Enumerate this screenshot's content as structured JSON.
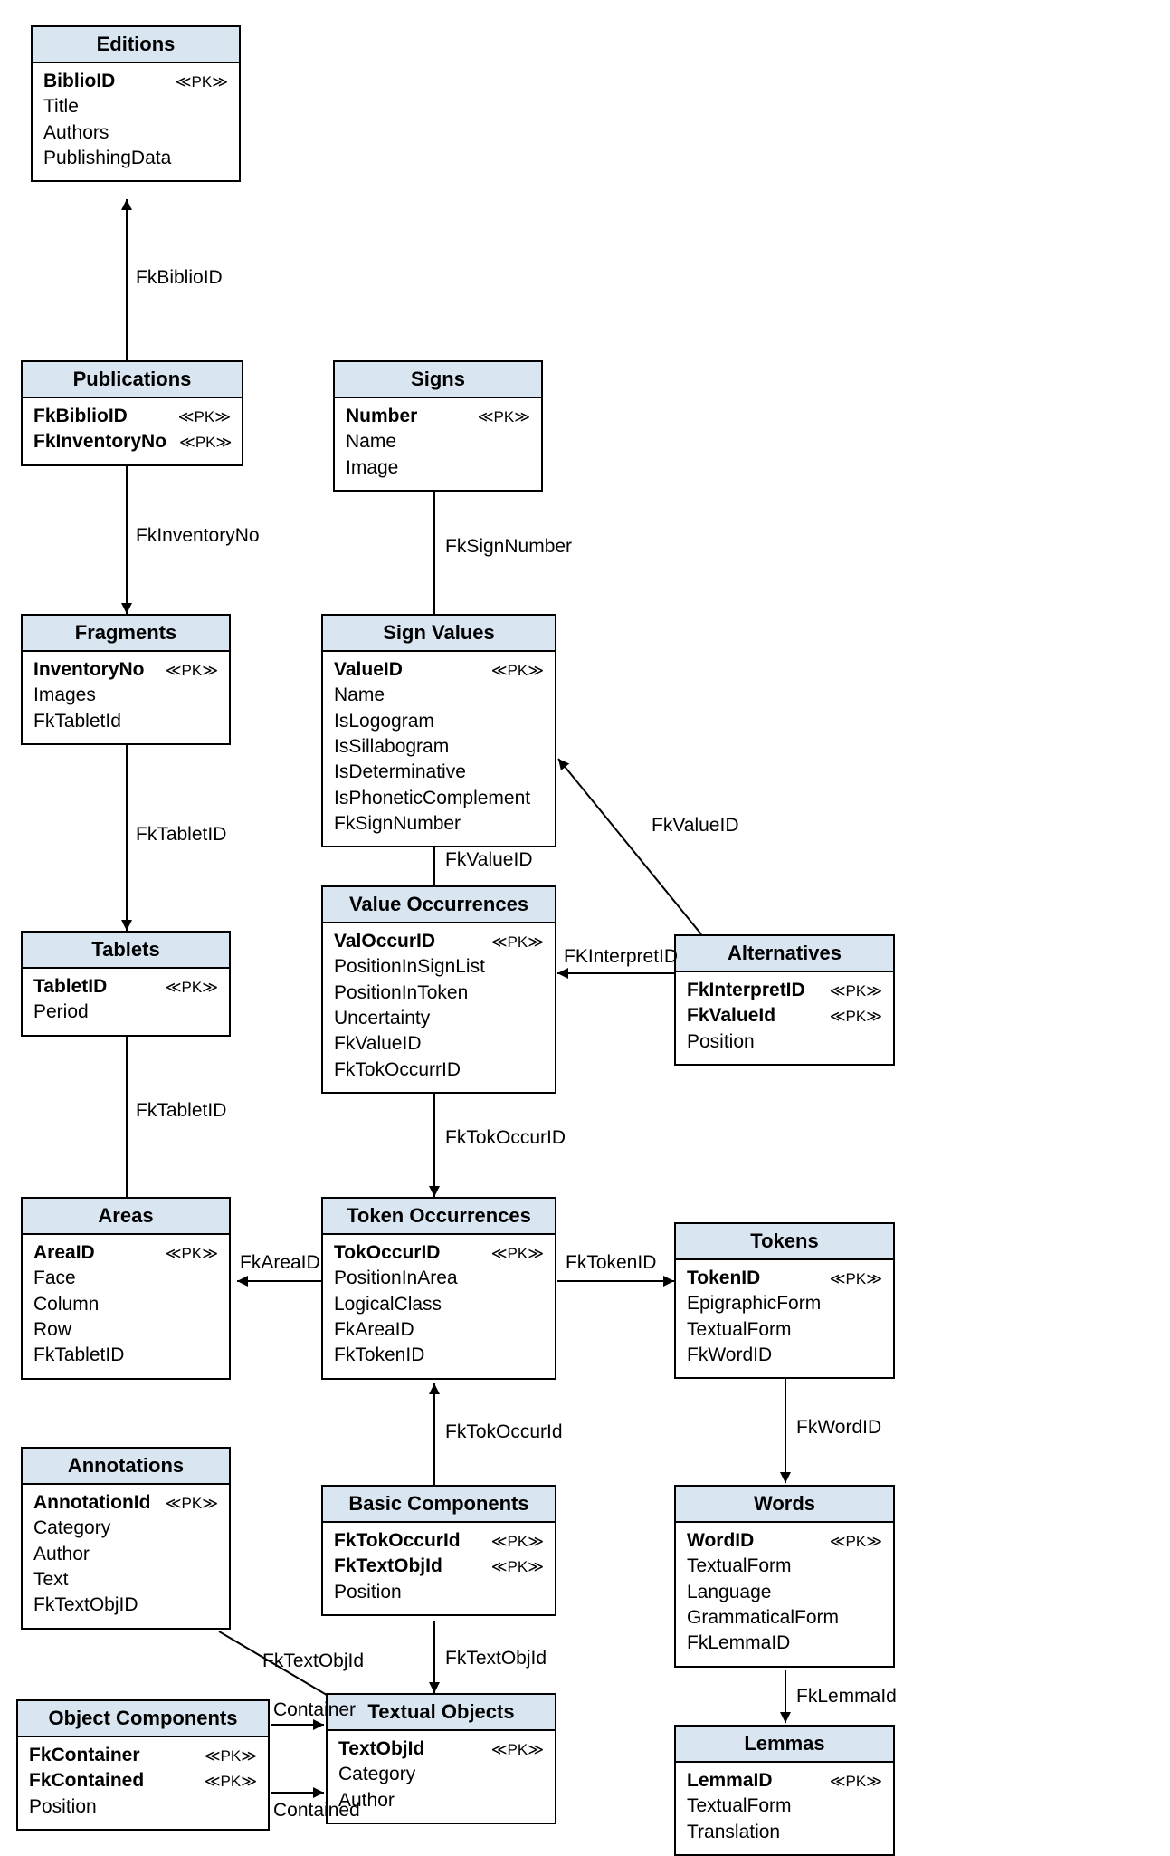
{
  "pk_marker": "≪PK≫",
  "entities": {
    "editions": {
      "title": "Editions",
      "attrs": [
        {
          "name": "BiblioID",
          "bold": true,
          "pk": true
        },
        {
          "name": "Title"
        },
        {
          "name": "Authors"
        },
        {
          "name": "PublishingData"
        }
      ]
    },
    "publications": {
      "title": "Publications",
      "attrs": [
        {
          "name": "FkBiblioID",
          "bold": true,
          "pk": true
        },
        {
          "name": "FkInventoryNo",
          "bold": true,
          "pk": true
        }
      ]
    },
    "fragments": {
      "title": "Fragments",
      "attrs": [
        {
          "name": "InventoryNo",
          "bold": true,
          "pk": true
        },
        {
          "name": "Images"
        },
        {
          "name": "FkTabletId"
        }
      ]
    },
    "tablets": {
      "title": "Tablets",
      "attrs": [
        {
          "name": "TabletID",
          "bold": true,
          "pk": true
        },
        {
          "name": "Period"
        }
      ]
    },
    "areas": {
      "title": "Areas",
      "attrs": [
        {
          "name": "AreaID",
          "bold": true,
          "pk": true
        },
        {
          "name": "Face"
        },
        {
          "name": "Column"
        },
        {
          "name": "Row"
        },
        {
          "name": "FkTabletID"
        }
      ]
    },
    "annotations": {
      "title": "Annotations",
      "attrs": [
        {
          "name": "AnnotationId",
          "bold": true,
          "pk": true
        },
        {
          "name": "Category"
        },
        {
          "name": "Author"
        },
        {
          "name": "Text"
        },
        {
          "name": "FkTextObjID"
        }
      ]
    },
    "object_components": {
      "title": "Object Components",
      "attrs": [
        {
          "name": "FkContainer",
          "bold": true,
          "pk": true
        },
        {
          "name": "FkContained",
          "bold": true,
          "pk": true
        },
        {
          "name": "Position"
        }
      ]
    },
    "signs": {
      "title": "Signs",
      "attrs": [
        {
          "name": "Number",
          "bold": true,
          "pk": true
        },
        {
          "name": "Name"
        },
        {
          "name": "Image"
        }
      ]
    },
    "sign_values": {
      "title": "Sign Values",
      "attrs": [
        {
          "name": "ValueID",
          "bold": true,
          "pk": true
        },
        {
          "name": "Name"
        },
        {
          "name": "IsLogogram"
        },
        {
          "name": "IsSillabogram"
        },
        {
          "name": "IsDeterminative"
        },
        {
          "name": "IsPhoneticComplement"
        },
        {
          "name": "FkSignNumber"
        }
      ]
    },
    "value_occurrences": {
      "title": "Value Occurrences",
      "attrs": [
        {
          "name": "ValOccurID",
          "bold": true,
          "pk": true
        },
        {
          "name": "PositionInSignList"
        },
        {
          "name": "PositionInToken"
        },
        {
          "name": "Uncertainty"
        },
        {
          "name": "FkValueID"
        },
        {
          "name": "FkTokOccurrID"
        }
      ]
    },
    "token_occurrences": {
      "title": "Token Occurrences",
      "attrs": [
        {
          "name": "TokOccurID",
          "bold": true,
          "pk": true
        },
        {
          "name": "PositionInArea"
        },
        {
          "name": "LogicalClass"
        },
        {
          "name": "FkAreaID"
        },
        {
          "name": "FkTokenID"
        }
      ]
    },
    "basic_components": {
      "title": "Basic Components",
      "attrs": [
        {
          "name": "FkTokOccurId",
          "bold": true,
          "pk": true
        },
        {
          "name": "FkTextObjId",
          "bold": true,
          "pk": true
        },
        {
          "name": "Position"
        }
      ]
    },
    "textual_objects": {
      "title": "Textual Objects",
      "attrs": [
        {
          "name": "TextObjId",
          "bold": true,
          "pk": true
        },
        {
          "name": "Category"
        },
        {
          "name": "Author"
        }
      ]
    },
    "alternatives": {
      "title": "Alternatives",
      "attrs": [
        {
          "name": "FkInterpretID",
          "bold": true,
          "pk": true
        },
        {
          "name": "FkValueId",
          "bold": true,
          "pk": true
        },
        {
          "name": "Position"
        }
      ]
    },
    "tokens": {
      "title": "Tokens",
      "attrs": [
        {
          "name": "TokenID",
          "bold": true,
          "pk": true
        },
        {
          "name": "EpigraphicForm"
        },
        {
          "name": "TextualForm"
        },
        {
          "name": "FkWordID"
        }
      ]
    },
    "words": {
      "title": "Words",
      "attrs": [
        {
          "name": "WordID",
          "bold": true,
          "pk": true
        },
        {
          "name": "TextualForm"
        },
        {
          "name": "Language"
        },
        {
          "name": "GrammaticalForm"
        },
        {
          "name": "FkLemmaID"
        }
      ]
    },
    "lemmas": {
      "title": "Lemmas",
      "attrs": [
        {
          "name": "LemmaID",
          "bold": true,
          "pk": true
        },
        {
          "name": "TextualForm"
        },
        {
          "name": "Translation"
        }
      ]
    }
  },
  "edge_labels": {
    "fk_biblio_id": "FkBiblioID",
    "fk_inventory_no": "FkInventoryNo",
    "fk_tablet_id_1": "FkTabletID",
    "fk_tablet_id_2": "FkTabletID",
    "fk_sign_number": "FkSignNumber",
    "fk_value_id_1": "FkValueID",
    "fk_value_id_2": "FkValueID",
    "fk_interpret_id": "FKInterpretID",
    "fk_tok_occur_id_1": "FkTokOccurID",
    "fk_tok_occur_id_2": "FkTokOccurId",
    "fk_area_id": "FkAreaID",
    "fk_token_id": "FkTokenID",
    "fk_word_id": "FkWordID",
    "fk_lemma_id": "FkLemmaId",
    "fk_text_obj_id_1": "FkTextObjId",
    "fk_text_obj_id_2": "FkTextObjId",
    "container": "Container",
    "contained": "Contained"
  }
}
